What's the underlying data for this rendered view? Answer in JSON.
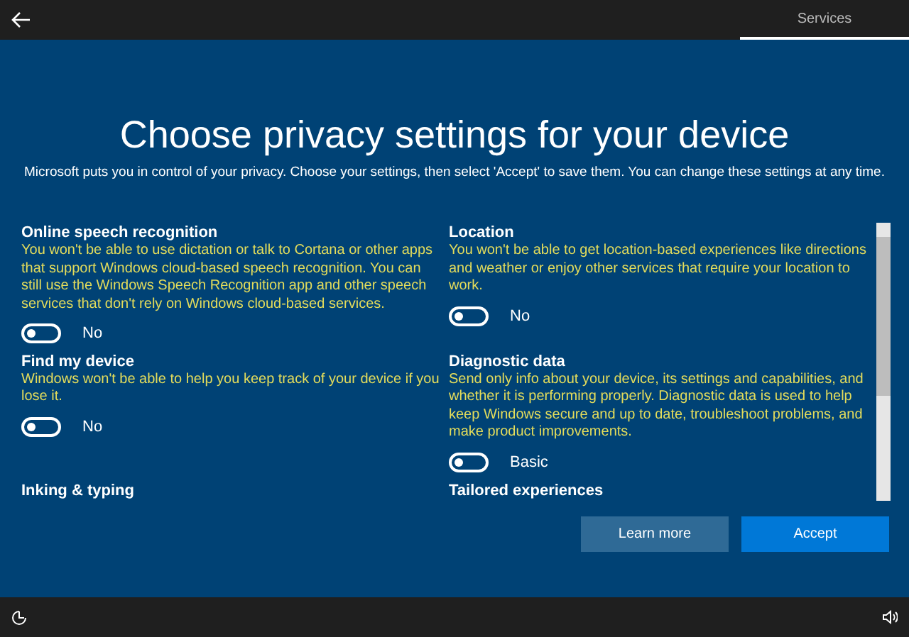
{
  "top_bar": {
    "tabs": [
      {
        "label": "Services",
        "selected": true
      }
    ]
  },
  "title": "Choose privacy settings for your device",
  "subtitle": "Microsoft puts you in control of your privacy. Choose your settings, then select 'Accept' to save them. You can change these settings at any time.",
  "columns": [
    {
      "sections": [
        {
          "title": "Online speech recognition",
          "description": "You won't be able to use dictation or talk to Cortana or other apps that support Windows cloud-based speech recognition. You can still use the Windows Speech Recognition app and other speech services that don't rely on Windows cloud-based services.",
          "toggle": {
            "on": false,
            "label": "No"
          }
        },
        {
          "title": "Find my device",
          "description": "Windows won't be able to help you keep track of your device if you lose it.",
          "toggle": {
            "on": false,
            "label": "No"
          }
        },
        {
          "title": "Inking & typing"
        }
      ]
    },
    {
      "sections": [
        {
          "title": "Location",
          "description": "You won't be able to get location-based experiences like directions and weather or enjoy other services that require your location to work.",
          "toggle": {
            "on": false,
            "label": "No"
          }
        },
        {
          "title": "Diagnostic data",
          "description": "Send only info about your device, its settings and capabilities, and whether it is performing properly. Diagnostic data is used to help keep Windows secure and up to date, troubleshoot problems, and make product improvements.",
          "toggle": {
            "on": false,
            "label": "Basic"
          }
        },
        {
          "title": "Tailored experiences"
        }
      ]
    }
  ],
  "buttons": [
    {
      "label": "Learn more",
      "kind": "secondary"
    },
    {
      "label": "Accept",
      "kind": "primary"
    }
  ]
}
